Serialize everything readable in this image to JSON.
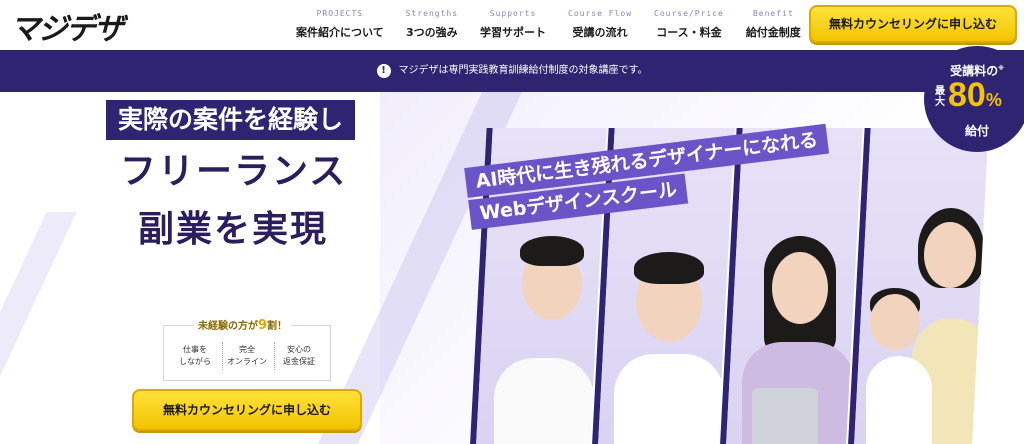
{
  "header": {
    "logo": "マジデザ",
    "nav": [
      {
        "en": "PROJECTS",
        "ja": "案件紹介について"
      },
      {
        "en": "Strengths",
        "ja": "3つの強み"
      },
      {
        "en": "Supports",
        "ja": "学習サポート"
      },
      {
        "en": "Course Flow",
        "ja": "受講の流れ"
      },
      {
        "en": "Course/Price",
        "ja": "コース・料金"
      },
      {
        "en": "Benefit",
        "ja": "給付金制度"
      }
    ],
    "cta_label": "無料カウンセリングに申し込む"
  },
  "notice": {
    "icon": "!",
    "text": "マジデザは専門実践教育訓練給付制度の対象講座です。"
  },
  "hero": {
    "title_badge": "実際の案件を経験し",
    "title_line1": "フリーランス",
    "title_line2": "副業を実現",
    "catch1": "AI時代に生き残れるデザイナーになれる",
    "catch2": "Webデザインスクール",
    "features_head_pre": "未経験の方が",
    "features_head_num": "9",
    "features_head_post": "割！",
    "features": [
      {
        "line1": "仕事を",
        "line2": "しながら"
      },
      {
        "line1": "完全",
        "line2": "オンライン"
      },
      {
        "line1": "安心の",
        "line2": "返金保証"
      }
    ],
    "cta_label": "無料カウンセリングに申し込む"
  },
  "badge": {
    "top": "受講料の",
    "note": "※",
    "max": "最大",
    "percent": "80",
    "unit": "%",
    "bottom": "給付"
  },
  "colors": {
    "brand_navy": "#2e2472",
    "accent_yellow": "#f2c400",
    "catch_purple": "#6a55c8"
  }
}
